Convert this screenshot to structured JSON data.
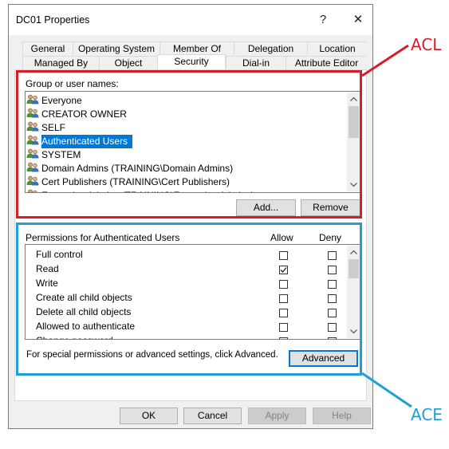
{
  "window": {
    "title": "DC01 Properties",
    "help_glyph": "?",
    "close_glyph": "✕"
  },
  "tabs_row1": [
    "General",
    "Operating System",
    "Member Of",
    "Delegation",
    "Location"
  ],
  "tabs_row2": [
    "Managed By",
    "Object",
    "Security",
    "Dial-in",
    "Attribute Editor"
  ],
  "active_tab": "Security",
  "group_section": {
    "label": "Group or user names:",
    "items": [
      {
        "name": "Everyone",
        "selected": false
      },
      {
        "name": "CREATOR OWNER",
        "selected": false
      },
      {
        "name": "SELF",
        "selected": false
      },
      {
        "name": "Authenticated Users",
        "selected": true
      },
      {
        "name": "SYSTEM",
        "selected": false
      },
      {
        "name": "Domain Admins (TRAINING\\Domain Admins)",
        "selected": false
      },
      {
        "name": "Cert Publishers (TRAINING\\Cert Publishers)",
        "selected": false
      },
      {
        "name": "Enterprise Admins (TRAINING\\Enterprise Admins)",
        "selected": false
      }
    ],
    "add_label": "Add...",
    "remove_label": "Remove"
  },
  "permissions": {
    "header": "Permissions for Authenticated Users",
    "allow_label": "Allow",
    "deny_label": "Deny",
    "rows": [
      {
        "name": "Full control",
        "allow": false,
        "deny": false
      },
      {
        "name": "Read",
        "allow": true,
        "deny": false
      },
      {
        "name": "Write",
        "allow": false,
        "deny": false
      },
      {
        "name": "Create all child objects",
        "allow": false,
        "deny": false
      },
      {
        "name": "Delete all child objects",
        "allow": false,
        "deny": false
      },
      {
        "name": "Allowed to authenticate",
        "allow": false,
        "deny": false
      },
      {
        "name": "Change password",
        "allow": false,
        "deny": false
      }
    ],
    "advanced_note": "For special permissions or advanced settings, click Advanced.",
    "advanced_label": "Advanced"
  },
  "footer": {
    "ok_label": "OK",
    "cancel_label": "Cancel",
    "apply_label": "Apply",
    "help_label": "Help"
  },
  "annotations": {
    "acl_label": "ACL",
    "ace_label": "ACE",
    "acl_color": "#d81e2b",
    "ace_color": "#1e9fd8"
  },
  "colors": {
    "selection": "#0078d7",
    "dialog_bg": "#f0f0f0"
  },
  "icons": {
    "group_item": "users-icon",
    "scroll_up": "chevron-up-icon",
    "scroll_down": "chevron-down-icon",
    "checked": "checkmark-icon"
  }
}
